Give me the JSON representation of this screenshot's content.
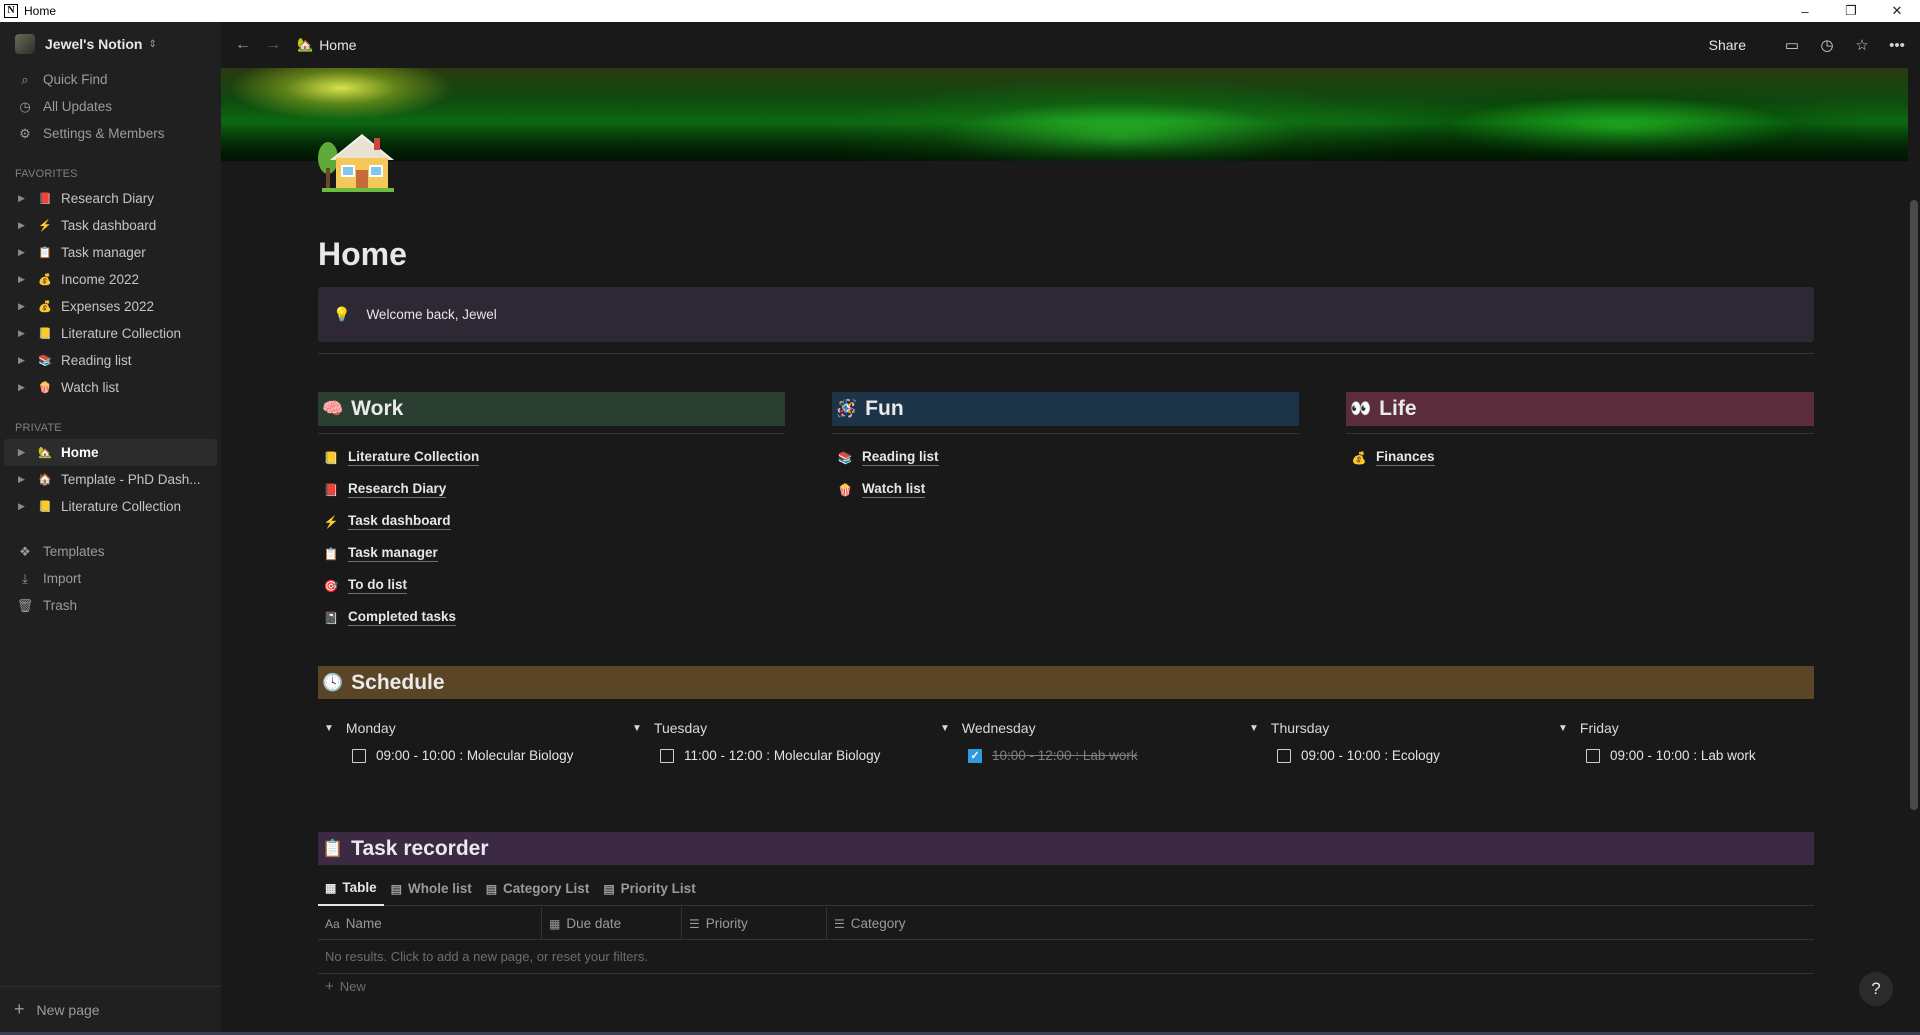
{
  "window": {
    "title": "Home",
    "minimize": "–",
    "restore": "❐",
    "close": "✕"
  },
  "sidebar": {
    "workspace": "Jewel's Notion",
    "nav": [
      {
        "label": "Quick Find",
        "icon": "search-icon",
        "glyph": "⌕"
      },
      {
        "label": "All Updates",
        "icon": "clock-icon",
        "glyph": "◷"
      },
      {
        "label": "Settings & Members",
        "icon": "gear-icon",
        "glyph": "⚙"
      }
    ],
    "favorites_label": "FAVORITES",
    "favorites": [
      {
        "label": "Research Diary",
        "glyph": "📕"
      },
      {
        "label": "Task dashboard",
        "glyph": "⚡"
      },
      {
        "label": "Task manager",
        "glyph": "📋"
      },
      {
        "label": "Income 2022",
        "glyph": "💰"
      },
      {
        "label": "Expenses 2022",
        "glyph": "💰"
      },
      {
        "label": "Literature Collection",
        "glyph": "📒"
      },
      {
        "label": "Reading list",
        "glyph": "📚"
      },
      {
        "label": "Watch list",
        "glyph": "🍿"
      }
    ],
    "private_label": "PRIVATE",
    "private": [
      {
        "label": "Home",
        "glyph": "🏡"
      },
      {
        "label": "Template - PhD Dash...",
        "glyph": "🏠"
      },
      {
        "label": "Literature Collection",
        "glyph": "📒"
      }
    ],
    "bottom": [
      {
        "label": "Templates",
        "glyph": "❖"
      },
      {
        "label": "Import",
        "glyph": "⤓"
      },
      {
        "label": "Trash",
        "glyph": "🗑"
      }
    ],
    "new_page": "New page"
  },
  "topbar": {
    "breadcrumb": "Home",
    "breadcrumb_glyph": "🏡",
    "share": "Share"
  },
  "page": {
    "title": "Home",
    "callout": "Welcome back, Jewel",
    "work": {
      "title": "Work",
      "glyph": "🧠",
      "color": "#2b3e32",
      "links": [
        {
          "label": "Literature Collection",
          "glyph": "📒"
        },
        {
          "label": "Research Diary",
          "glyph": "📕"
        },
        {
          "label": "Task dashboard",
          "glyph": "⚡"
        },
        {
          "label": "Task manager",
          "glyph": "📋"
        },
        {
          "label": "To do list",
          "glyph": "🎯"
        },
        {
          "label": "Completed tasks",
          "glyph": "📓"
        }
      ]
    },
    "fun": {
      "title": "Fun",
      "glyph": "🪅",
      "color": "#1c3348",
      "links": [
        {
          "label": "Reading list",
          "glyph": "📚"
        },
        {
          "label": "Watch list",
          "glyph": "🍿"
        }
      ]
    },
    "life": {
      "title": "Life",
      "glyph": "👀",
      "color": "#5a2c3c",
      "links": [
        {
          "label": "Finances",
          "glyph": "💰"
        }
      ]
    },
    "schedule": {
      "title": "Schedule",
      "glyph": "🕓",
      "days": [
        {
          "day": "Monday",
          "task": "09:00 - 10:00 : Molecular Biology",
          "done": false
        },
        {
          "day": "Tuesday",
          "task": "11:00 - 12:00 : Molecular Biology",
          "done": false
        },
        {
          "day": "Wednesday",
          "task": "10:00 - 12:00 : Lab work",
          "done": true
        },
        {
          "day": "Thursday",
          "task": "09:00 - 10:00 : Ecology",
          "done": false
        },
        {
          "day": "Friday",
          "task": "09:00 - 10:00 : Lab work",
          "done": false
        }
      ]
    },
    "task_recorder": {
      "title": "Task recorder",
      "glyph": "📋",
      "views": [
        {
          "label": "Table",
          "glyph": "▦"
        },
        {
          "label": "Whole list",
          "glyph": "▤"
        },
        {
          "label": "Category List",
          "glyph": "▤"
        },
        {
          "label": "Priority List",
          "glyph": "▤"
        }
      ],
      "columns": [
        {
          "label": "Name",
          "glyph": "Aa"
        },
        {
          "label": "Due date",
          "glyph": "▦"
        },
        {
          "label": "Priority",
          "glyph": "☰"
        },
        {
          "label": "Category",
          "glyph": "☰"
        }
      ],
      "empty": "No results. Click to add a new page, or reset your filters.",
      "new": "New"
    },
    "help": "?"
  }
}
